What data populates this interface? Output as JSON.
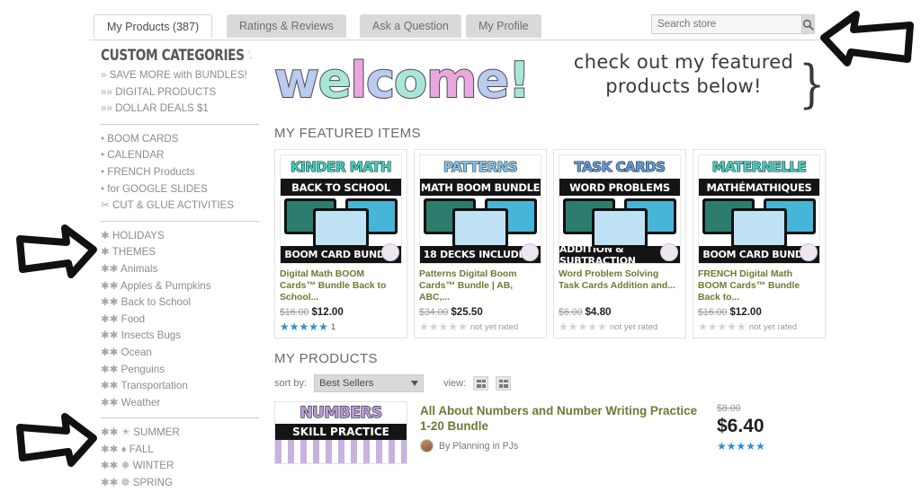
{
  "tabs": [
    {
      "label": "My Products (387)",
      "active": true
    },
    {
      "label": "Ratings & Reviews",
      "active": false
    },
    {
      "label": "Ask a Question",
      "active": false
    },
    {
      "label": "My Profile",
      "active": false
    }
  ],
  "search": {
    "placeholder": "Search store",
    "value": "",
    "icon": "search-icon"
  },
  "sidebar": {
    "heading": "CUSTOM CATEGORIES",
    "groups": [
      {
        "items": [
          {
            "marker": "»",
            "label": "SAVE MORE with BUNDLES!"
          },
          {
            "marker": "»»",
            "label": "DIGITAL PRODUCTS"
          },
          {
            "marker": "»»",
            "label": "DOLLAR DEALS $1"
          }
        ]
      },
      {
        "items": [
          {
            "marker": "•",
            "label": "BOOM CARDS"
          },
          {
            "marker": "•",
            "label": "CALENDAR"
          },
          {
            "marker": "•",
            "label": "FRENCH Products"
          },
          {
            "marker": "•",
            "label": "for GOOGLE SLIDES"
          },
          {
            "marker": "✂",
            "label": "CUT & GLUE ACTIVITIES"
          }
        ]
      },
      {
        "items": [
          {
            "marker": "✱",
            "label": "HOLIDAYS"
          },
          {
            "marker": "✱",
            "label": "THEMES"
          },
          {
            "marker": "✱✱",
            "label": "Animals"
          },
          {
            "marker": "✱✱",
            "label": "Apples & Pumpkins"
          },
          {
            "marker": "✱✱",
            "label": "Back to School"
          },
          {
            "marker": "✱✱",
            "label": "Food"
          },
          {
            "marker": "✱✱",
            "label": "Insects Bugs"
          },
          {
            "marker": "✱✱",
            "label": "Ocean"
          },
          {
            "marker": "✱✱",
            "label": "Penguins"
          },
          {
            "marker": "✱✱",
            "label": "Transportation"
          },
          {
            "marker": "✱✱",
            "label": "Weather"
          }
        ]
      },
      {
        "items": [
          {
            "marker": "✱✱ ☀",
            "label": "SUMMER"
          },
          {
            "marker": "✱✱ ♦",
            "label": "FALL"
          },
          {
            "marker": "✱✱ ❅",
            "label": "WINTER"
          },
          {
            "marker": "✱✱ ❁",
            "label": "SPRING"
          }
        ]
      }
    ]
  },
  "banner": {
    "welcome_word": "welcome!",
    "welcome_letters": [
      {
        "ch": "w",
        "color": "#b9cbee"
      },
      {
        "ch": "e",
        "color": "#a8e6d8"
      },
      {
        "ch": "l",
        "color": "#e9a8dd"
      },
      {
        "ch": "c",
        "color": "#b9cbee"
      },
      {
        "ch": "o",
        "color": "#a8e6d8"
      },
      {
        "ch": "m",
        "color": "#e9a8dd"
      },
      {
        "ch": "e",
        "color": "#b9cbee"
      },
      {
        "ch": "!",
        "color": "#a8e6d8"
      }
    ],
    "tagline_line1": "check out my featured",
    "tagline_line2": "products below!",
    "brace": "}"
  },
  "featured": {
    "title": "MY FEATURED ITEMS",
    "cards": [
      {
        "thumb_top": "KINDER MATH",
        "thumb_top_color": "#3ecfbe",
        "thumb_sub": "BACK TO SCHOOL",
        "thumb_bottom": "BOOM CARD BUNDLE",
        "title": "Digital Math BOOM Cards™ Bundle Back to School...",
        "price_old": "$16.00",
        "price_new": "$12.00",
        "rating": 5,
        "rating_count": "1",
        "rating_text": ""
      },
      {
        "thumb_top": "PATTERNS",
        "thumb_top_color": "#7fc4e8",
        "thumb_sub": "MATH BOOM BUNDLE",
        "thumb_bottom": "18 DECKS INCLUDED!",
        "title": "Patterns Digital Boom Cards™ Bundle | AB, ABC,...",
        "price_old": "$34.00",
        "price_new": "$25.50",
        "rating": 0,
        "rating_count": "",
        "rating_text": "not yet rated"
      },
      {
        "thumb_top": "TASK CARDS",
        "thumb_top_color": "#5b9bd5",
        "thumb_sub": "WORD PROBLEMS",
        "thumb_bottom": "ADDITION & SUBTRACTION",
        "title": "Word Problem Solving Task Cards Addition and...",
        "price_old": "$6.00",
        "price_new": "$4.80",
        "rating": 0,
        "rating_count": "",
        "rating_text": "not yet rated"
      },
      {
        "thumb_top": "MATERNELLE",
        "thumb_top_color": "#3ecfbe",
        "thumb_sub": "MATHÉMATHIQUES",
        "thumb_bottom": "BOOM CARD BUNDLE",
        "title": "FRENCH Digital Math BOOM Cards™ Bundle Back to...",
        "price_old": "$16.00",
        "price_new": "$12.00",
        "rating": 0,
        "rating_count": "",
        "rating_text": "not yet rated"
      }
    ]
  },
  "my_products": {
    "title": "MY PRODUCTS",
    "sort_label": "sort by:",
    "sort_value": "Best Sellers",
    "view_label": "view:",
    "view_list_icon": "list-view-icon",
    "view_grid_icon": "grid-view-icon",
    "rows": [
      {
        "thumb_top": "NUMBERS",
        "thumb_sub": "SKILL PRACTICE",
        "title": "All About Numbers and Number Writing Practice 1-20 Bundle",
        "by": "By Planning in PJs",
        "price_old": "$8.00",
        "price_new": "$6.40",
        "rating": 5
      }
    ]
  },
  "annotations": {
    "arrow_top_right": "left-pointing-arrow",
    "arrow_left_upper": "right-pointing-arrow",
    "arrow_left_lower": "right-pointing-arrow"
  },
  "colors": {
    "title_green": "#6d7a33",
    "star_blue": "#2a8fd4",
    "star_grey": "#d2d2d2"
  }
}
